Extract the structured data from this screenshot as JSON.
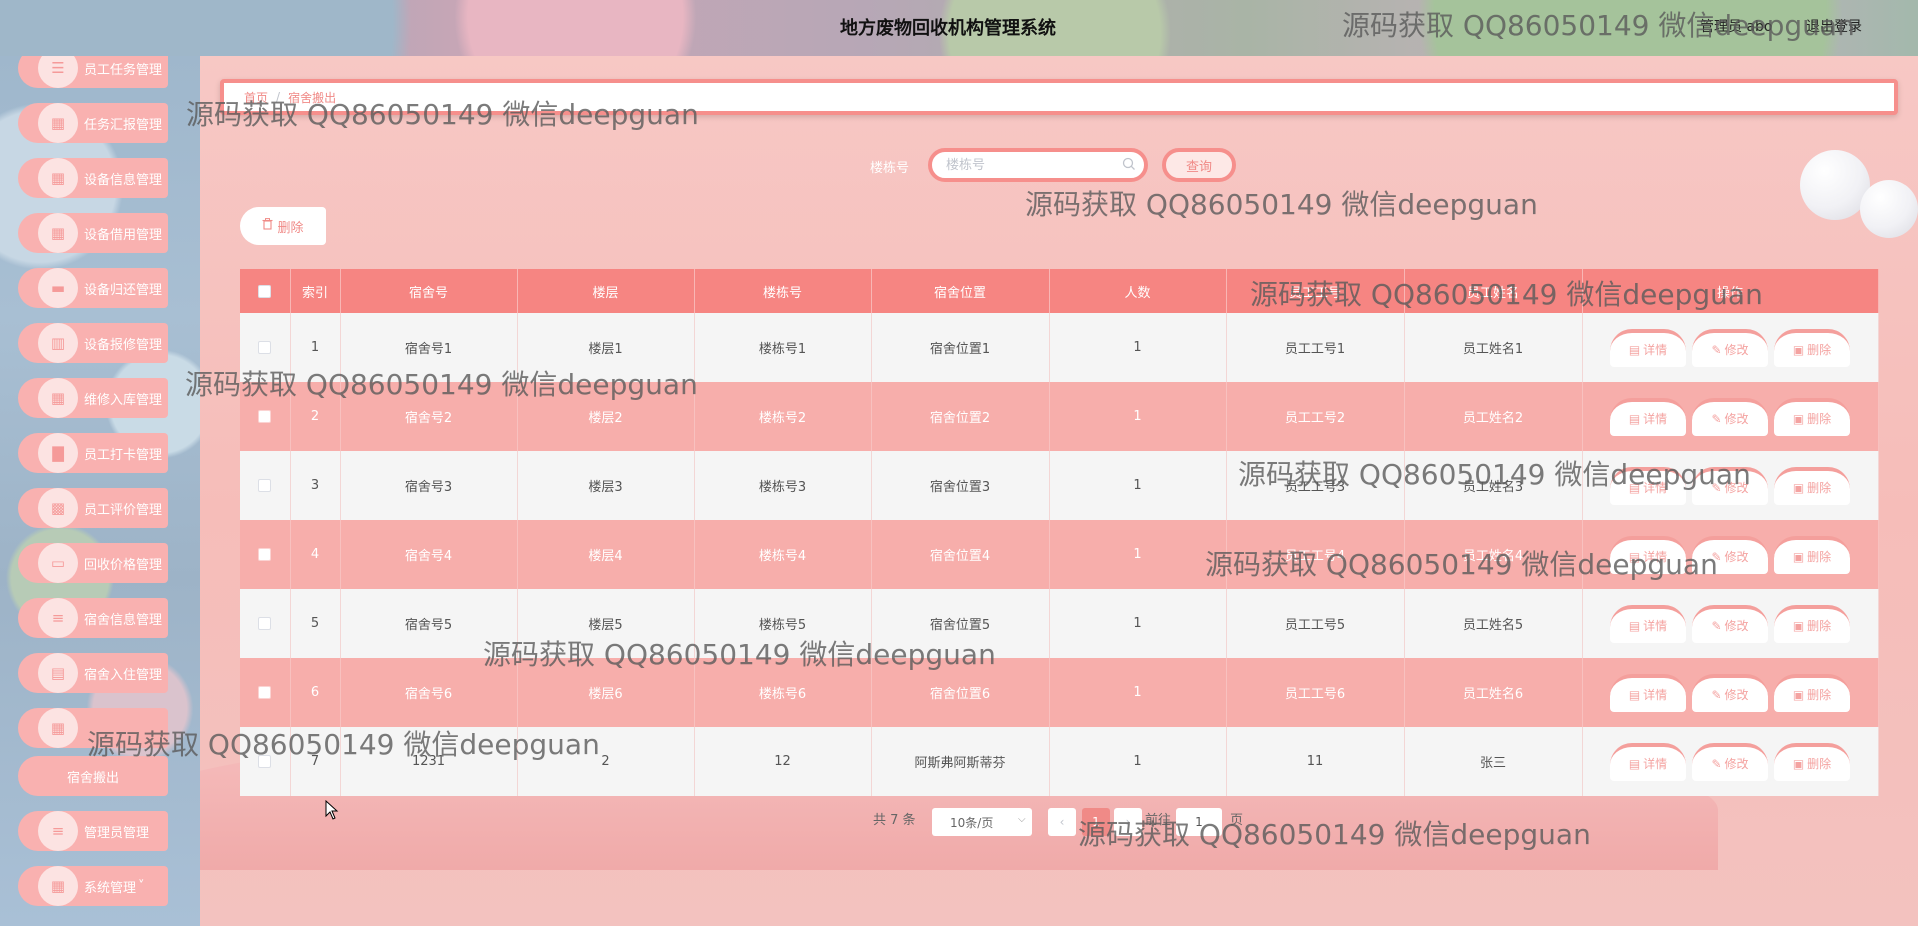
{
  "header": {
    "title": "地方废物回收机构管理系统",
    "user_label": "管理员 abo",
    "logout_label": "退出登录"
  },
  "sidebar": {
    "items": [
      {
        "label": "员工任务管理",
        "icon": "list-icon"
      },
      {
        "label": "任务汇报管理",
        "icon": "grid-icon"
      },
      {
        "label": "设备信息管理",
        "icon": "grid-icon"
      },
      {
        "label": "设备借用管理",
        "icon": "grid-icon"
      },
      {
        "label": "设备归还管理",
        "icon": "chat-icon"
      },
      {
        "label": "设备报修管理",
        "icon": "chart-icon"
      },
      {
        "label": "维修入库管理",
        "icon": "grid-icon"
      },
      {
        "label": "员工打卡管理",
        "icon": "bar-chart-icon"
      },
      {
        "label": "员工评价管理",
        "icon": "table-icon"
      },
      {
        "label": "回收价格管理",
        "icon": "monitor-icon"
      },
      {
        "label": "宿舍信息管理",
        "icon": "menu-icon"
      },
      {
        "label": "宿舍入住管理",
        "icon": "drive-icon"
      },
      {
        "label": "",
        "icon": "grid-icon"
      },
      {
        "label": "宿舍搬出",
        "icon": ""
      },
      {
        "label": "管理员管理",
        "icon": "menu-icon"
      },
      {
        "label": "系统管理",
        "icon": "grid-icon"
      }
    ]
  },
  "breadcrumb": {
    "home": "首页",
    "separator": "/",
    "current": "宿舍搬出"
  },
  "search": {
    "label": "楼栋号",
    "placeholder": "楼栋号",
    "button_label": "查询"
  },
  "toolbar": {
    "delete_label": "删除"
  },
  "table": {
    "columns": [
      "",
      "索引",
      "宿舍号",
      "楼层",
      "楼栋号",
      "宿舍位置",
      "人数",
      "员工工号",
      "员工姓名",
      "操作"
    ],
    "rows": [
      [
        "1",
        "宿舍号1",
        "楼层1",
        "楼栋号1",
        "宿舍位置1",
        "1",
        "员工工号1",
        "员工姓名1"
      ],
      [
        "2",
        "宿舍号2",
        "楼层2",
        "楼栋号2",
        "宿舍位置2",
        "1",
        "员工工号2",
        "员工姓名2"
      ],
      [
        "3",
        "宿舍号3",
        "楼层3",
        "楼栋号3",
        "宿舍位置3",
        "1",
        "员工工号3",
        "员工姓名3"
      ],
      [
        "4",
        "宿舍号4",
        "楼层4",
        "楼栋号4",
        "宿舍位置4",
        "1",
        "员工工号4",
        "员工姓名4"
      ],
      [
        "5",
        "宿舍号5",
        "楼层5",
        "楼栋号5",
        "宿舍位置5",
        "1",
        "员工工号5",
        "员工姓名5"
      ],
      [
        "6",
        "宿舍号6",
        "楼层6",
        "楼栋号6",
        "宿舍位置6",
        "1",
        "员工工号6",
        "员工姓名6"
      ],
      [
        "7",
        "1231",
        "2",
        "12",
        "阿斯弗阿斯蒂芬",
        "1",
        "11",
        "张三"
      ]
    ],
    "actions": {
      "detail": "详情",
      "edit": "修改",
      "delete": "删除"
    }
  },
  "pagination": {
    "total_text": "共 7 条",
    "page_size": "10条/页",
    "current_page": "1",
    "goto_label": "前往",
    "goto_value": "1",
    "page_suffix": "页"
  },
  "watermark_text": "源码获取 QQ86050149 微信deepguan",
  "colors": {
    "accent": "#f68582",
    "row_even": "#f7aeab",
    "row_odd": "#f5f5f5"
  }
}
